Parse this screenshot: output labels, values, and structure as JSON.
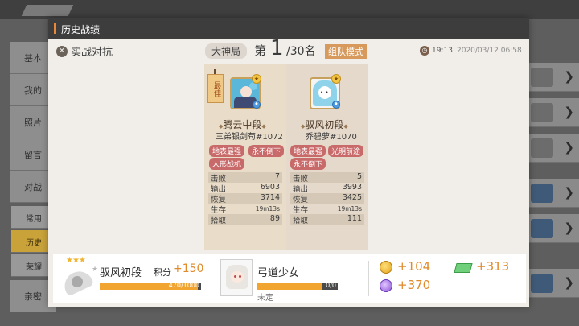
{
  "background": {
    "side_items": [
      "基本",
      "我的",
      "照片",
      "留言",
      "对战",
      "常用",
      "历史",
      "荣耀",
      "亲密"
    ]
  },
  "dialog": {
    "title": "历史战绩",
    "mode_label": "实战对抗",
    "rank_tag": "大神局",
    "rank_prefix": "第",
    "rank_number": "1",
    "rank_total": "/30名",
    "team_mode": "组队模式",
    "match_duration": "19:13",
    "match_datetime": "2020/03/12 06:58"
  },
  "players": [
    {
      "best_label": "最佳",
      "tier": "腾云中段",
      "name": "三弟银剑苟#1072",
      "tags": [
        "地表最强",
        "永不倒下",
        "人形战机"
      ],
      "stats": [
        {
          "label": "击败",
          "value": "7"
        },
        {
          "label": "输出",
          "value": "6903"
        },
        {
          "label": "恢复",
          "value": "3714"
        },
        {
          "label": "生存",
          "value": "19m13s"
        },
        {
          "label": "拾取",
          "value": "89"
        }
      ]
    },
    {
      "tier": "驭风初段",
      "name": "乔碧萝#1070",
      "tags": [
        "地表最强",
        "光明前途",
        "永不倒下"
      ],
      "stats": [
        {
          "label": "击败",
          "value": "5"
        },
        {
          "label": "输出",
          "value": "3993"
        },
        {
          "label": "恢复",
          "value": "3425"
        },
        {
          "label": "生存",
          "value": "19m13s"
        },
        {
          "label": "拾取",
          "value": "111"
        }
      ]
    }
  ],
  "result": {
    "tier": "驭风初段",
    "score_label": "积分",
    "score_delta": "+150",
    "tier_progress_text": "470/1000",
    "tier_progress": 0.97,
    "hero_name": "弓道少女",
    "hero_progress_text": "0/0",
    "hero_progress": 0.8,
    "hero_status": "未定",
    "gold_reward": "+104",
    "bill_reward": "+313",
    "crystal_reward": "+370",
    "colors": {
      "accent": "#e08a2a",
      "progress": "#f1a530",
      "tag": "#c96a6a"
    }
  }
}
